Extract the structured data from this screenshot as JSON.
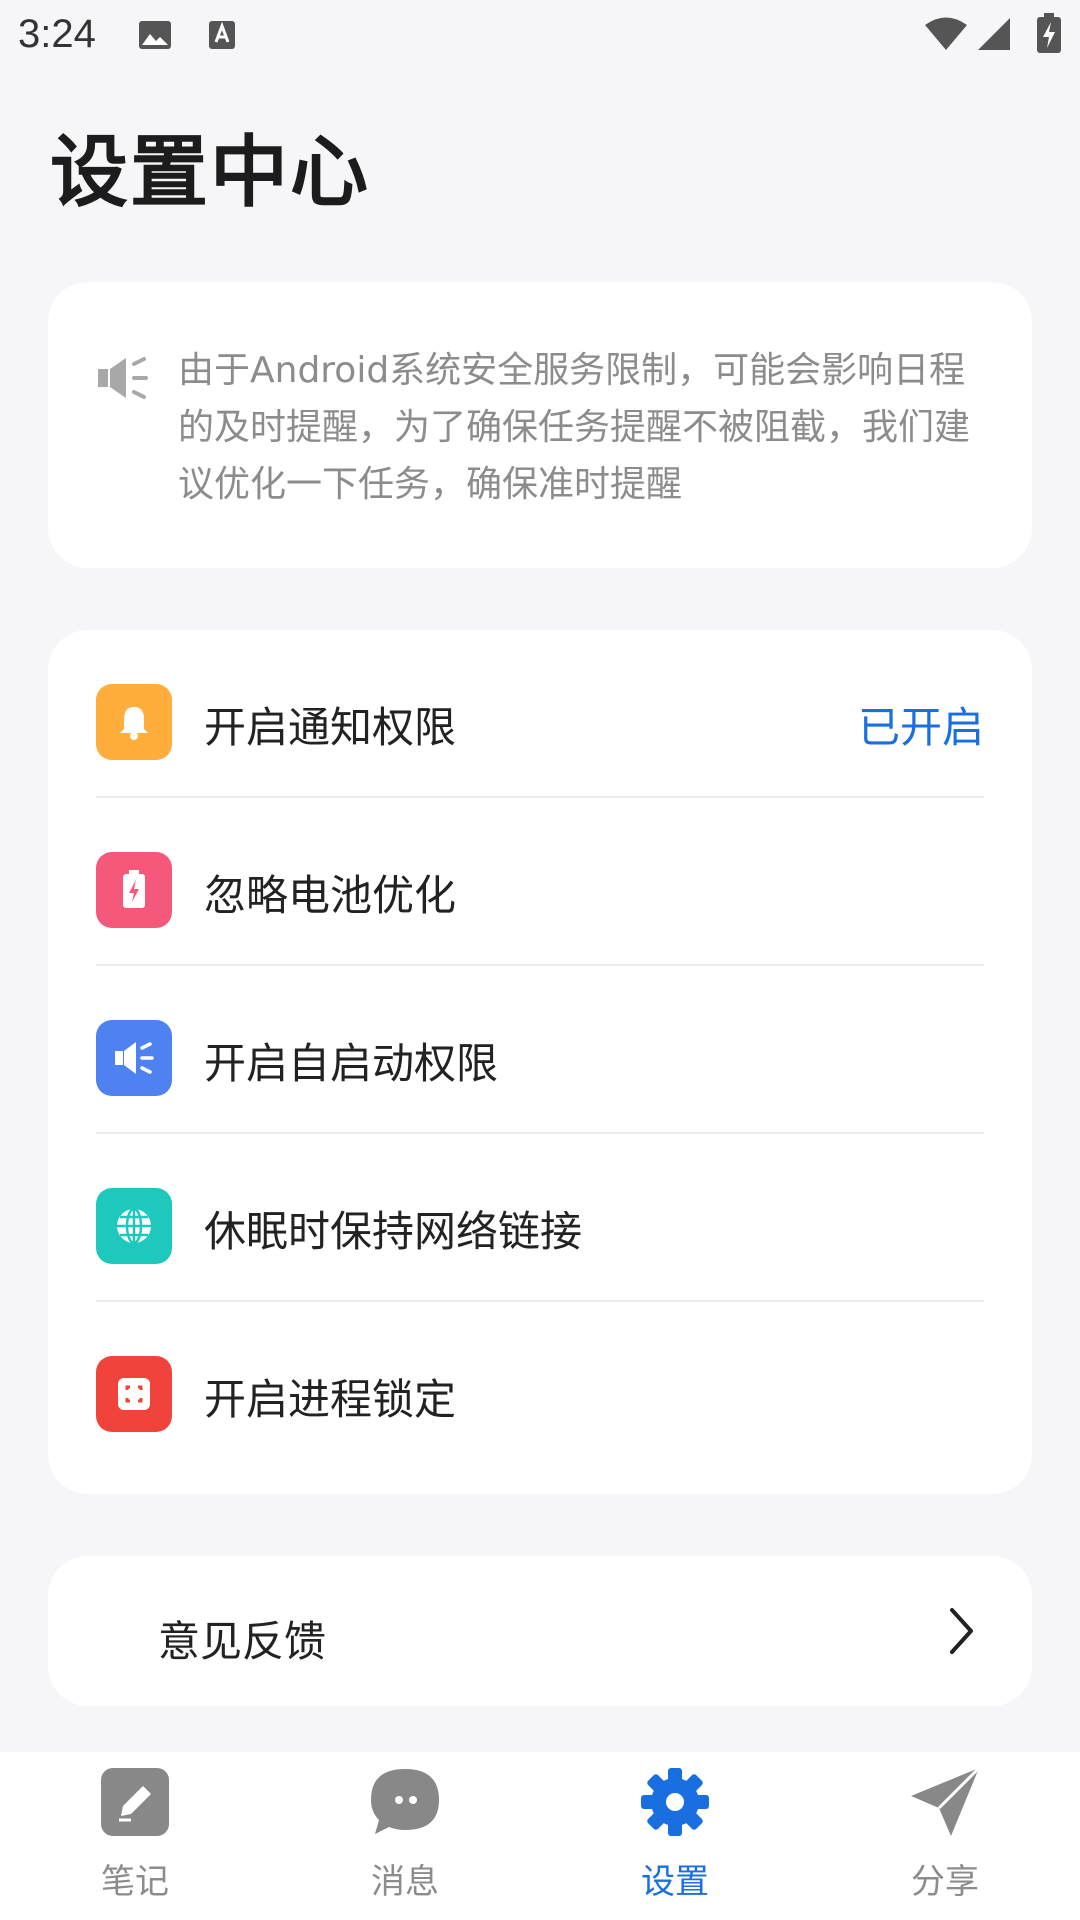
{
  "status_bar": {
    "time": "3:24"
  },
  "page": {
    "title": "设置中心"
  },
  "notice": {
    "text": "由于Android系统安全服务限制，可能会影响日程的及时提醒，为了确保任务提醒不被阻截，我们建议优化一下任务，确保准时提醒"
  },
  "permissions": {
    "items": [
      {
        "label": "开启通知权限",
        "status": "已开启",
        "icon": "bell-icon",
        "color": "#ffae3c"
      },
      {
        "label": "忽略电池优化",
        "status": "",
        "icon": "battery-icon",
        "color": "#f4587a"
      },
      {
        "label": "开启自启动权限",
        "status": "",
        "icon": "speaker-icon",
        "color": "#4e82f0"
      },
      {
        "label": "休眠时保持网络链接",
        "status": "",
        "icon": "globe-icon",
        "color": "#1fc8bc"
      },
      {
        "label": "开启进程锁定",
        "status": "",
        "icon": "lock-frame-icon",
        "color": "#f0433c"
      }
    ]
  },
  "feedback": {
    "label": "意见反馈",
    "icon": "chevron-right-icon"
  },
  "tabs": [
    {
      "label": "笔记",
      "icon": "edit-icon",
      "active": false
    },
    {
      "label": "消息",
      "icon": "chat-icon",
      "active": false
    },
    {
      "label": "设置",
      "icon": "gear-icon",
      "active": true
    },
    {
      "label": "分享",
      "icon": "send-icon",
      "active": false
    }
  ],
  "colors": {
    "accent": "#1a6fe0",
    "inactive": "#8c8c8c",
    "background": "#f6f6f8"
  }
}
